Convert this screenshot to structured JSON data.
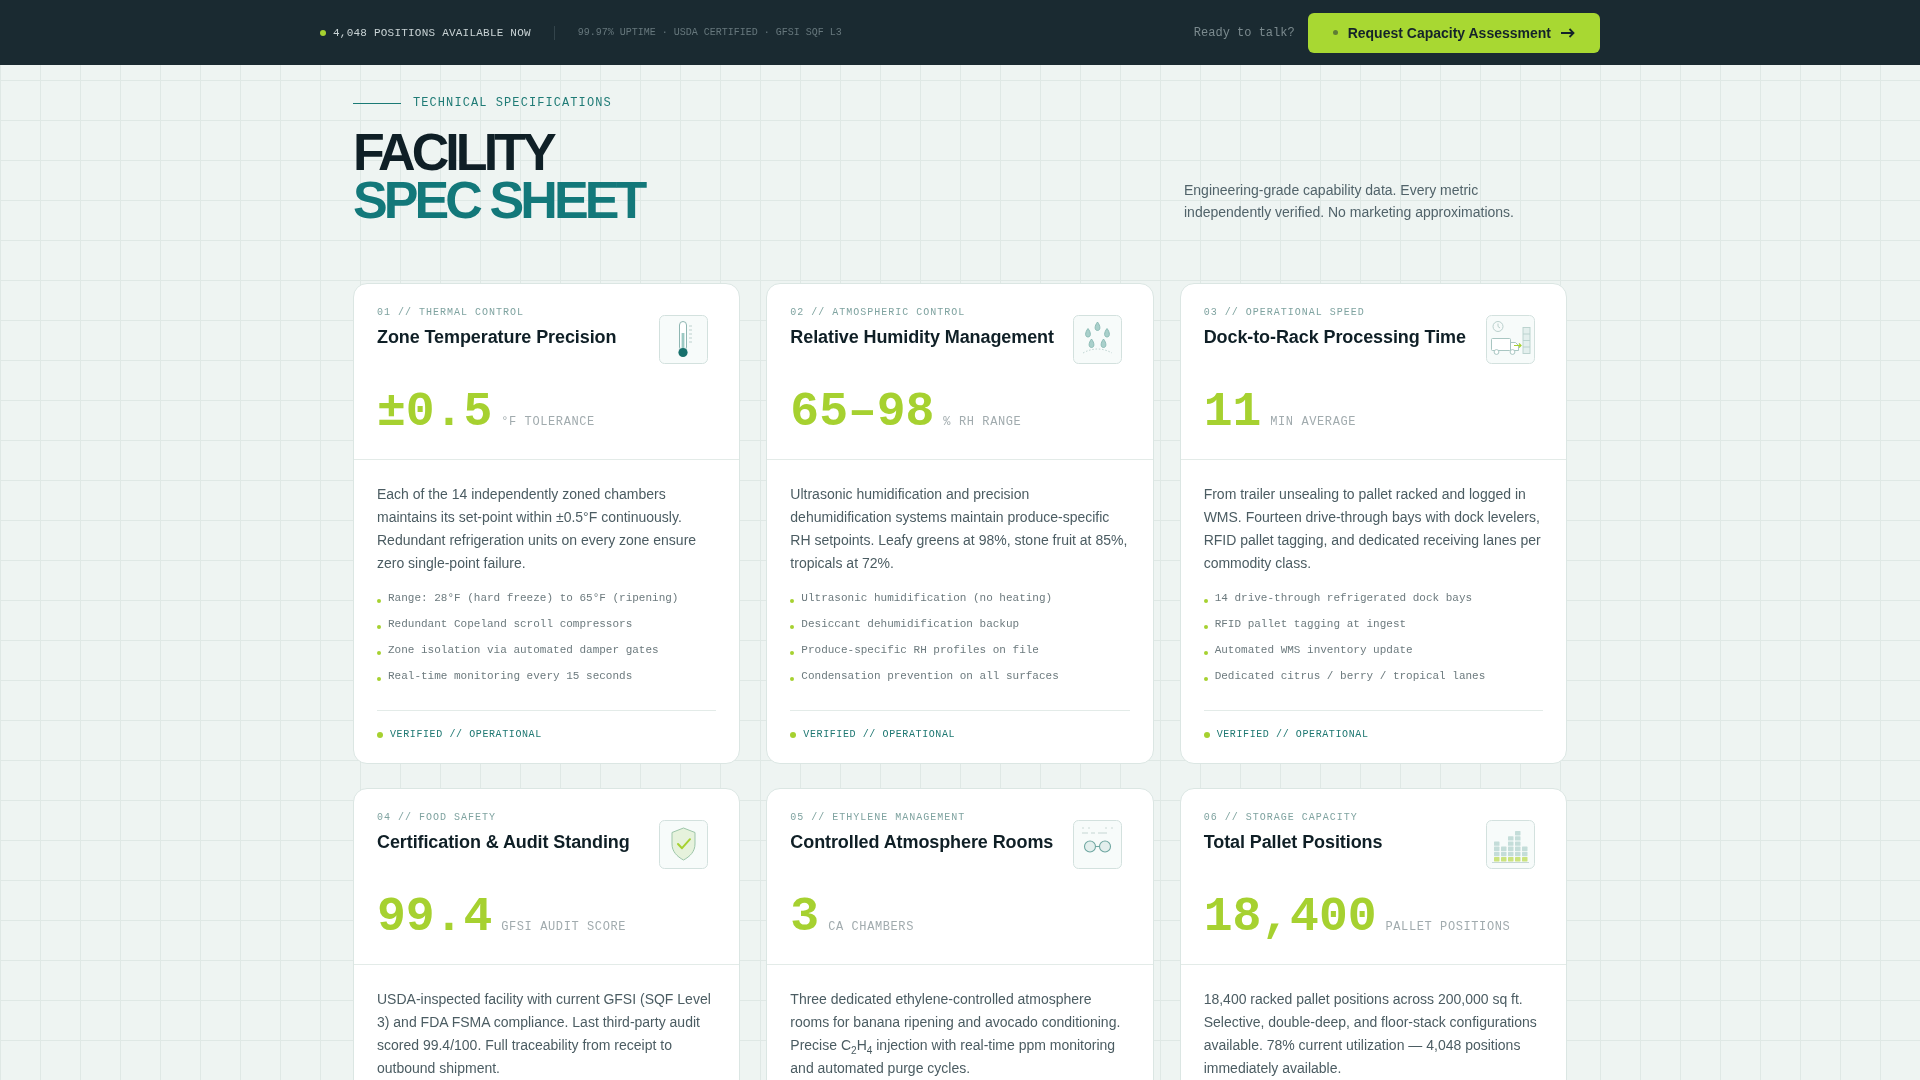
{
  "top_bar": {
    "availability": "4,048 POSITIONS AVAILABLE NOW",
    "credentials": "99.97% UPTIME · USDA CERTIFIED · GFSI SQF L3",
    "prompt": "Ready to talk?",
    "cta_button": "Request Capacity Assessment"
  },
  "header": {
    "eyebrow": "TECHNICAL SPECIFICATIONS",
    "title_lines": [
      "FACILITY",
      "SPEC SHEET"
    ],
    "intro": "Engineering-grade capability data. Every metric independently verified. No marketing approximations."
  },
  "cards": [
    {
      "category": "01 // THERMAL CONTROL",
      "title": "Zone Temperature Precision",
      "value": "±0.5",
      "unit": "°F TOLERANCE",
      "description": "Each of the 14 independently zoned chambers maintains its set-point within ±0.5°F continuously. Redundant refrigeration units on every zone ensure zero single-point failure.",
      "bullets": [
        "Range: 28°F (hard freeze) to 65°F (ripening)",
        "Redundant Copeland scroll compressors",
        "Zone isolation via automated damper gates",
        "Real-time monitoring every 15 seconds"
      ],
      "status": "VERIFIED // OPERATIONAL"
    },
    {
      "category": "02 // ATMOSPHERIC CONTROL",
      "title": "Relative Humidity Management",
      "value": "65–98",
      "unit": "% RH RANGE",
      "description": "Ultrasonic humidification and precision dehumidification systems maintain produce-specific RH setpoints. Leafy greens at 98%, stone fruit at 85%, tropicals at 72%.",
      "bullets": [
        "Ultrasonic humidification (no heating)",
        "Desiccant dehumidification backup",
        "Produce-specific RH profiles on file",
        "Condensation prevention on all surfaces"
      ],
      "status": "VERIFIED // OPERATIONAL"
    },
    {
      "category": "03 // OPERATIONAL SPEED",
      "title": "Dock-to-Rack Processing Time",
      "value": "11",
      "unit": "MIN AVERAGE",
      "description": "From trailer unsealing to pallet racked and logged in WMS. Fourteen drive-through bays with dock levelers, RFID pallet tagging, and dedicated receiving lanes per commodity class.",
      "bullets": [
        "14 drive-through refrigerated dock bays",
        "RFID pallet tagging at ingest",
        "Automated WMS inventory update",
        "Dedicated citrus / berry / tropical lanes"
      ],
      "status": "VERIFIED // OPERATIONAL"
    },
    {
      "category": "04 // FOOD SAFETY",
      "title": "Certification & Audit Standing",
      "value": "99.4",
      "unit": "GFSI AUDIT SCORE",
      "description": "USDA-inspected facility with current GFSI (SQF Level 3) and FDA FSMA compliance. Last third-party audit scored 99.4/100. Full traceability from receipt to outbound shipment."
    },
    {
      "category": "05 // ETHYLENE MANAGEMENT",
      "title": "Controlled Atmosphere Rooms",
      "value": "3",
      "unit": "CA CHAMBERS",
      "description": "Three dedicated ethylene-controlled atmosphere rooms for banana ripening and avocado conditioning. Precise C$_{2}$H$_{4}$ injection with real-time ppm monitoring and automated purge cycles."
    },
    {
      "category": "06 // STORAGE CAPACITY",
      "title": "Total Pallet Positions",
      "value": "18,400",
      "unit": "PALLET POSITIONS",
      "description": "18,400 racked pallet positions across 200,000 sq ft. Selective, double-deep, and floor-stack configurations available. 78% current utilization — 4,048 positions immediately available."
    }
  ]
}
